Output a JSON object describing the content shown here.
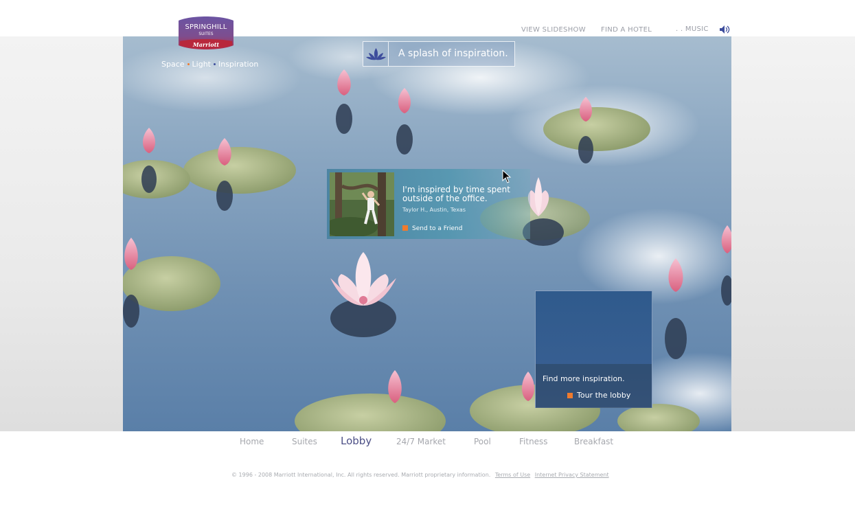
{
  "logo": {
    "line1": "SPRINGHILL",
    "line2": "SUITES",
    "brand": "Marriott"
  },
  "tagline": {
    "words": [
      "Space",
      "Light",
      "Inspiration"
    ],
    "dot_colors": [
      "#f07b2d",
      "#3d4d9c"
    ]
  },
  "top_nav": {
    "slideshow": "VIEW SLIDESHOW",
    "find_hotel": "FIND A HOTEL",
    "music": ". . MUSIC"
  },
  "splash": {
    "text": "A splash of inspiration.",
    "icon": "lotus-icon"
  },
  "quote": {
    "text": "I'm inspired by time spent outside of the office.",
    "author": "Taylor H., Austin, Texas",
    "link": "Send to a Friend"
  },
  "lobby": {
    "caption": "Find more inspiration.",
    "link": "Tour the lobby"
  },
  "bottom_nav": {
    "items": [
      "Home",
      "Suites",
      "Lobby",
      "24/7 Market",
      "Pool",
      "Fitness",
      "Breakfast"
    ],
    "active": "Lobby"
  },
  "footer": {
    "copyright": "© 1996 - 2008 Marriott International, Inc. All rights reserved. Marriott proprietary information.",
    "terms": "Terms of Use",
    "privacy": "Internet Privacy Statement"
  },
  "colors": {
    "accent_orange": "#f07b2d",
    "nav_active": "#4c4f86",
    "nav_inactive": "#a5a7ad",
    "logo_purple": "#5b3f8f",
    "logo_red": "#b8283c"
  }
}
